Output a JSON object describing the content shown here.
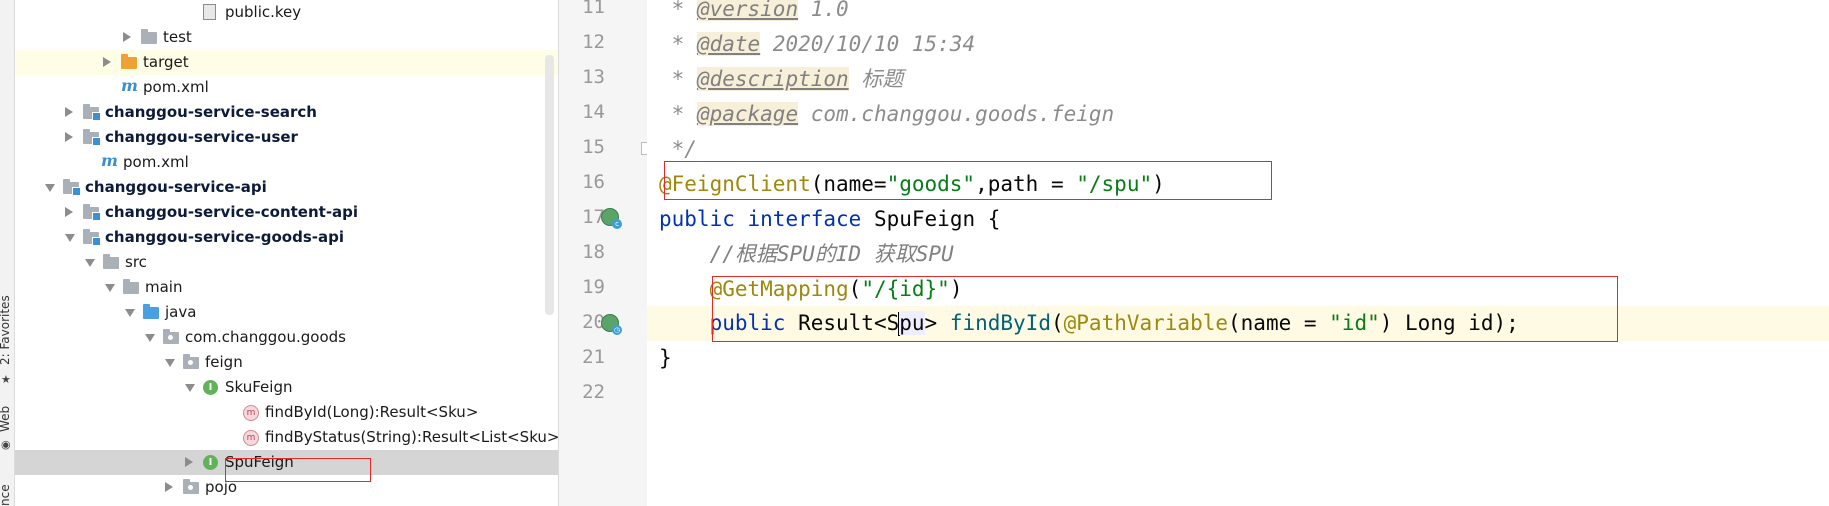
{
  "strip": {
    "tab1": "2: Favorites",
    "tab2": "Web",
    "tab3": "nce"
  },
  "tree": [
    {
      "label": "public.key",
      "indent": 160,
      "icon": "file",
      "tw": "none",
      "bold": false,
      "hl": ""
    },
    {
      "label": "test",
      "indent": 98,
      "icon": "folder",
      "tw": "closed",
      "bold": false,
      "hl": ""
    },
    {
      "label": "target",
      "indent": 78,
      "icon": "folder-orange",
      "tw": "closed",
      "bold": false,
      "hl": "yellow"
    },
    {
      "label": "pom.xml",
      "indent": 78,
      "icon": "maven",
      "tw": "none",
      "bold": false,
      "hl": ""
    },
    {
      "label": "changgou-service-search",
      "indent": 40,
      "icon": "module",
      "tw": "closed",
      "bold": true,
      "hl": ""
    },
    {
      "label": "changgou-service-user",
      "indent": 40,
      "icon": "module",
      "tw": "closed",
      "bold": true,
      "hl": ""
    },
    {
      "label": "pom.xml",
      "indent": 58,
      "icon": "maven",
      "tw": "none",
      "bold": false,
      "hl": ""
    },
    {
      "label": "changgou-service-api",
      "indent": 20,
      "icon": "module",
      "tw": "open",
      "bold": true,
      "hl": ""
    },
    {
      "label": "changgou-service-content-api",
      "indent": 40,
      "icon": "module",
      "tw": "closed",
      "bold": true,
      "hl": ""
    },
    {
      "label": "changgou-service-goods-api",
      "indent": 40,
      "icon": "module",
      "tw": "open",
      "bold": true,
      "hl": ""
    },
    {
      "label": "src",
      "indent": 60,
      "icon": "folder",
      "tw": "open",
      "bold": false,
      "hl": ""
    },
    {
      "label": "main",
      "indent": 80,
      "icon": "folder",
      "tw": "open",
      "bold": false,
      "hl": ""
    },
    {
      "label": "java",
      "indent": 100,
      "icon": "folder-blue",
      "tw": "open",
      "bold": false,
      "hl": ""
    },
    {
      "label": "com.changgou.goods",
      "indent": 120,
      "icon": "package",
      "tw": "open",
      "bold": false,
      "hl": ""
    },
    {
      "label": "feign",
      "indent": 140,
      "icon": "package",
      "tw": "open",
      "bold": false,
      "hl": ""
    },
    {
      "label": "SkuFeign",
      "indent": 160,
      "icon": "interface",
      "tw": "open",
      "bold": false,
      "hl": ""
    },
    {
      "label": "findById(Long):Result<Sku>",
      "indent": 200,
      "icon": "method",
      "tw": "none",
      "bold": false,
      "hl": ""
    },
    {
      "label": "findByStatus(String):Result<List<Sku>>",
      "indent": 200,
      "icon": "method",
      "tw": "none",
      "bold": false,
      "hl": ""
    },
    {
      "label": "SpuFeign",
      "indent": 160,
      "icon": "interface",
      "tw": "closed",
      "bold": false,
      "hl": "gray"
    },
    {
      "label": "pojo",
      "indent": 140,
      "icon": "package",
      "tw": "closed",
      "bold": false,
      "hl": ""
    }
  ],
  "line_numbers": [
    "11",
    "12",
    "13",
    "14",
    "15",
    "16",
    "17",
    "18",
    "19",
    "20",
    "21",
    "22"
  ],
  "code": {
    "l11": {
      "star": " * ",
      "tag": "@version",
      "rest": " 1.0"
    },
    "l12": {
      "star": " * ",
      "tag": "@date",
      "rest": " 2020/10/10 15:34"
    },
    "l13": {
      "star": " * ",
      "tag": "@description",
      "rest": " 标题"
    },
    "l14": {
      "star": " * ",
      "tag": "@package",
      "rest": " com.changgou.goods.feign"
    },
    "l15": " */",
    "l16": {
      "ann": "@FeignClient",
      "p1": "(name=",
      "s1": "\"goods\"",
      "p2": ",path = ",
      "s2": "\"/spu\"",
      "p3": ")"
    },
    "l17": {
      "kw1": "public",
      "kw2": "interface",
      "name": " SpuFeign {"
    },
    "l18": "    //根据SPU的ID 获取SPU",
    "l19": {
      "ann": "@GetMapping",
      "p1": "(",
      "s1": "\"/{id}\"",
      "p2": ")"
    },
    "l20": {
      "kw": "public",
      "t1": " Result<S",
      "t2": "pu",
      "t3": "> ",
      "fn": "findById",
      "p1": "(",
      "ann": "@PathVariable",
      "p2": "(name = ",
      "s1": "\"id\"",
      "p3": ") Long id);"
    },
    "l21": "}",
    "l22": ""
  }
}
